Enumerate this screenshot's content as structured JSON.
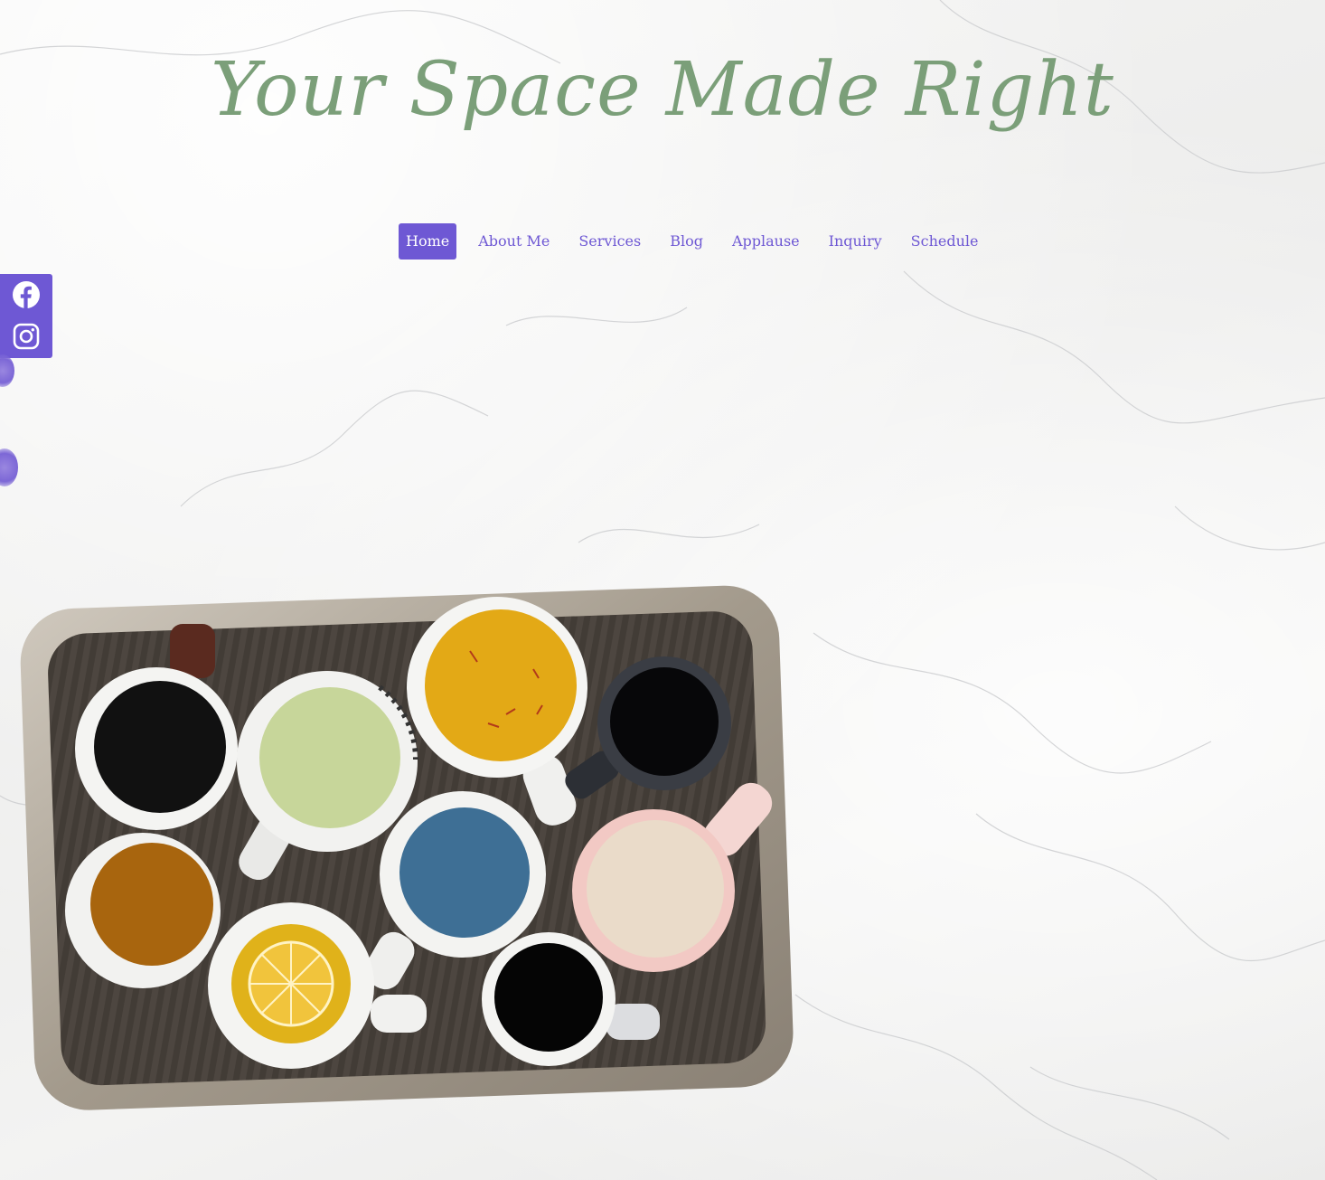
{
  "header": {
    "site_title": "Your Space Made Right"
  },
  "nav": {
    "items": [
      {
        "label": "Home",
        "active": true
      },
      {
        "label": "About Me",
        "active": false
      },
      {
        "label": "Services",
        "active": false
      },
      {
        "label": "Blog",
        "active": false
      },
      {
        "label": "Applause",
        "active": false
      },
      {
        "label": "Inquiry",
        "active": false
      },
      {
        "label": "Schedule",
        "active": false
      }
    ]
  },
  "social": {
    "links": [
      {
        "icon": "facebook-icon"
      },
      {
        "icon": "instagram-icon"
      }
    ]
  },
  "colors": {
    "accent": "#6e58d4",
    "title": "#7b9f79",
    "background": "#f1f1f0"
  }
}
